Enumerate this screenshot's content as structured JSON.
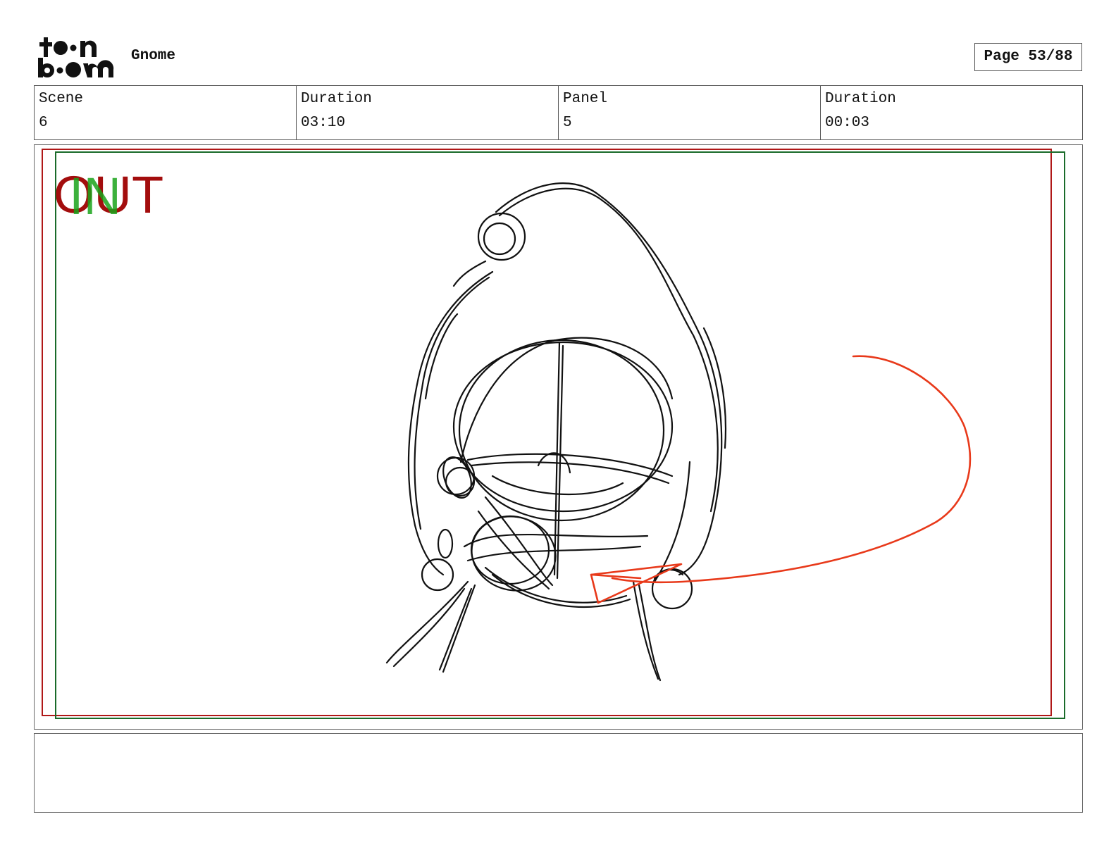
{
  "header": {
    "logo_line1": "toon",
    "logo_line2": "boom",
    "project_title": "Gnome",
    "page_label": "Page 53/88"
  },
  "info": {
    "scene_label": "Scene",
    "scene_value": "6",
    "scene_duration_label": "Duration",
    "scene_duration_value": "03:10",
    "panel_label": "Panel",
    "panel_value": "5",
    "panel_duration_label": "Duration",
    "panel_duration_value": "00:03"
  },
  "panel": {
    "in_marker": "IN",
    "out_marker": "OUT",
    "in_color": "#1aa31a",
    "out_color": "#a30d0d",
    "sketch_color": "#111111",
    "arrow_color": "#e8391a"
  },
  "notes": {
    "text": ""
  }
}
